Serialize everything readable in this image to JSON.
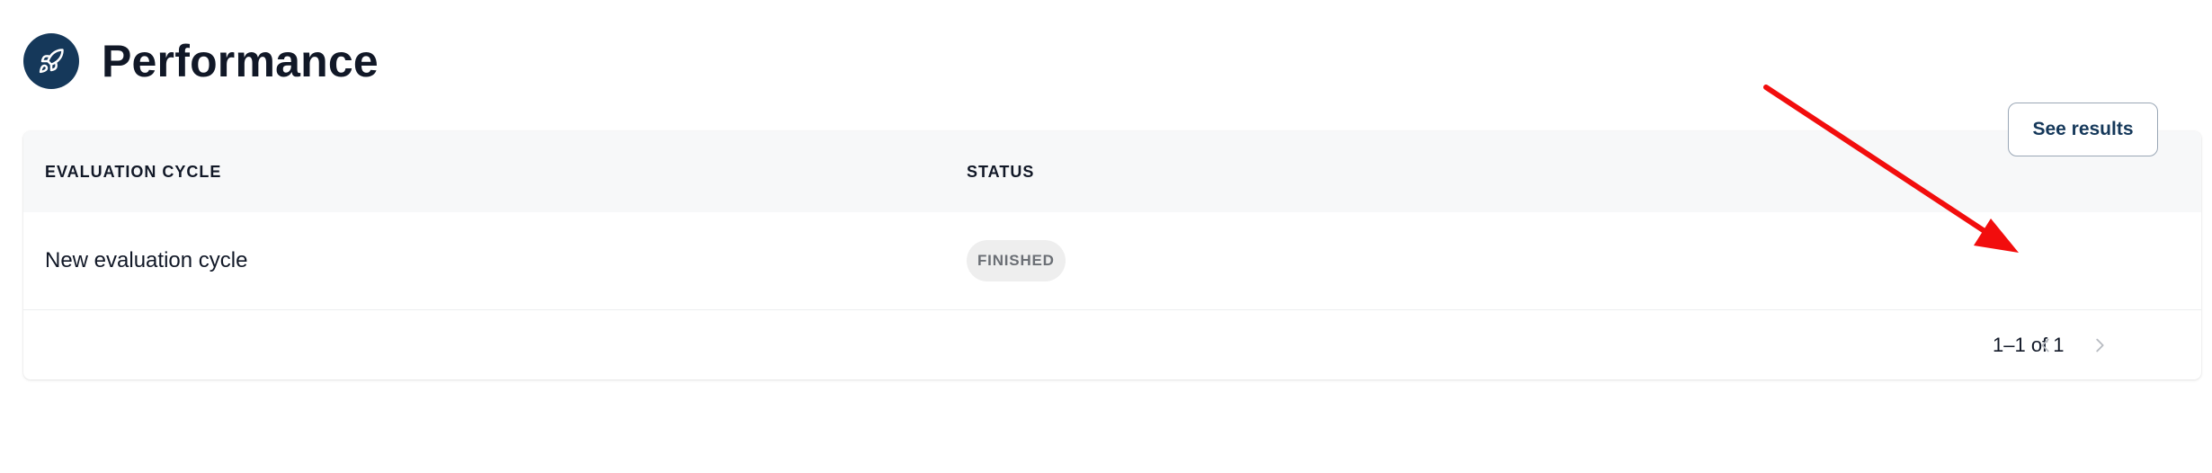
{
  "header": {
    "title": "Performance",
    "icon": "rocket-icon",
    "icon_bg_color": "#15385a"
  },
  "table": {
    "columns": [
      "EVALUATION CYCLE",
      "STATUS"
    ],
    "rows": [
      {
        "name": "New evaluation cycle",
        "status": "FINISHED",
        "action_label": "See results"
      }
    ]
  },
  "pagination": {
    "range_text": "1–1 of 1",
    "prev_icon": "chevron-left-icon",
    "next_icon": "chevron-right-icon"
  },
  "annotation": {
    "type": "arrow",
    "color": "#ff0000",
    "target": "see-results-button"
  },
  "colors": {
    "accent": "#15385a",
    "badge_bg": "#eeeeee",
    "badge_text": "#6b6f75",
    "header_row_bg": "#f7f8f9"
  }
}
